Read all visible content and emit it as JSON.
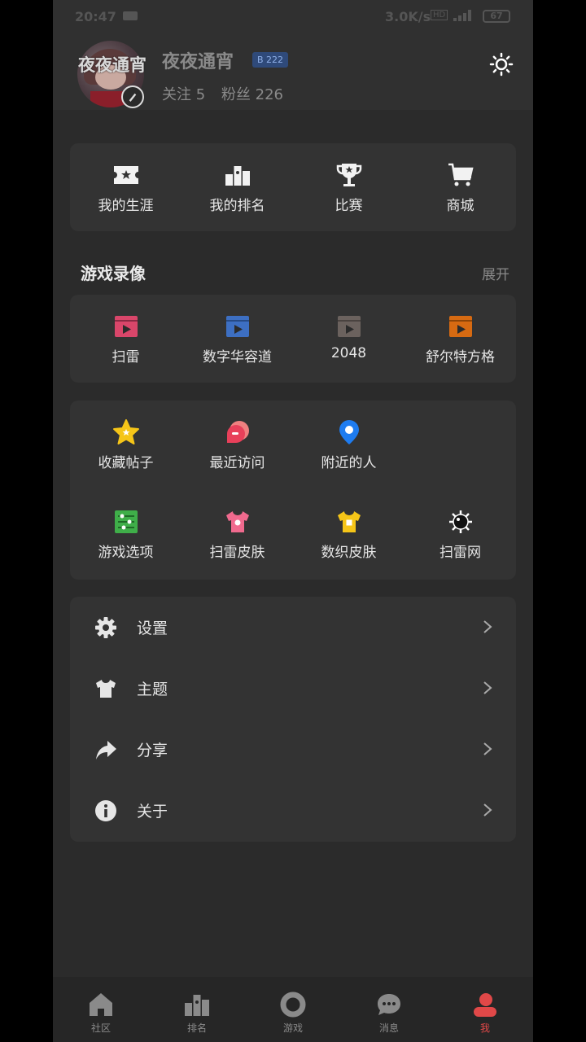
{
  "status_bar": {
    "time": "20:47",
    "network_speed": "3.0K/s",
    "hd": "HD",
    "battery": "67"
  },
  "profile": {
    "avatar_overlay_name": "夜夜通宵",
    "username": "夜夜通宵",
    "level_badge": "B 222",
    "following_label": "关注 5",
    "followers_label": "粉丝 226"
  },
  "quick_links": [
    {
      "label": "我的生涯",
      "icon": "ticket-icon"
    },
    {
      "label": "我的排名",
      "icon": "podium-icon"
    },
    {
      "label": "比赛",
      "icon": "trophy-icon"
    },
    {
      "label": "商城",
      "icon": "cart-icon"
    }
  ],
  "replays": {
    "title": "游戏录像",
    "expand_label": "展开",
    "items": [
      {
        "label": "扫雷",
        "color": "#d9466a"
      },
      {
        "label": "数字华容道",
        "color": "#3d6fc2"
      },
      {
        "label": "2048",
        "color": "#6b625e"
      },
      {
        "label": "舒尔特方格",
        "color": "#d66a12"
      }
    ]
  },
  "features": [
    {
      "label": "收藏帖子",
      "icon": "star-icon"
    },
    {
      "label": "最近访问",
      "icon": "recent-icon"
    },
    {
      "label": "附近的人",
      "icon": "location-pin-icon"
    },
    {
      "label": "游戏选项",
      "icon": "sliders-icon"
    },
    {
      "label": "扫雷皮肤",
      "icon": "shirt-pink-icon"
    },
    {
      "label": "数织皮肤",
      "icon": "shirt-yellow-icon"
    },
    {
      "label": "扫雷网",
      "icon": "mine-icon"
    }
  ],
  "menu": [
    {
      "label": "设置",
      "icon": "gear-icon"
    },
    {
      "label": "主题",
      "icon": "shirt-icon"
    },
    {
      "label": "分享",
      "icon": "share-arrow-icon"
    },
    {
      "label": "关于",
      "icon": "info-icon"
    }
  ],
  "tabs": [
    {
      "label": "社区",
      "icon": "home-icon"
    },
    {
      "label": "排名",
      "icon": "podium-icon"
    },
    {
      "label": "游戏",
      "icon": "game-ring-icon"
    },
    {
      "label": "消息",
      "icon": "chat-bubble-icon"
    },
    {
      "label": "我",
      "icon": "user-icon",
      "active": true
    }
  ],
  "colors": {
    "accent": "#e04848",
    "background": "#2b2b2b",
    "card": "#333333"
  }
}
